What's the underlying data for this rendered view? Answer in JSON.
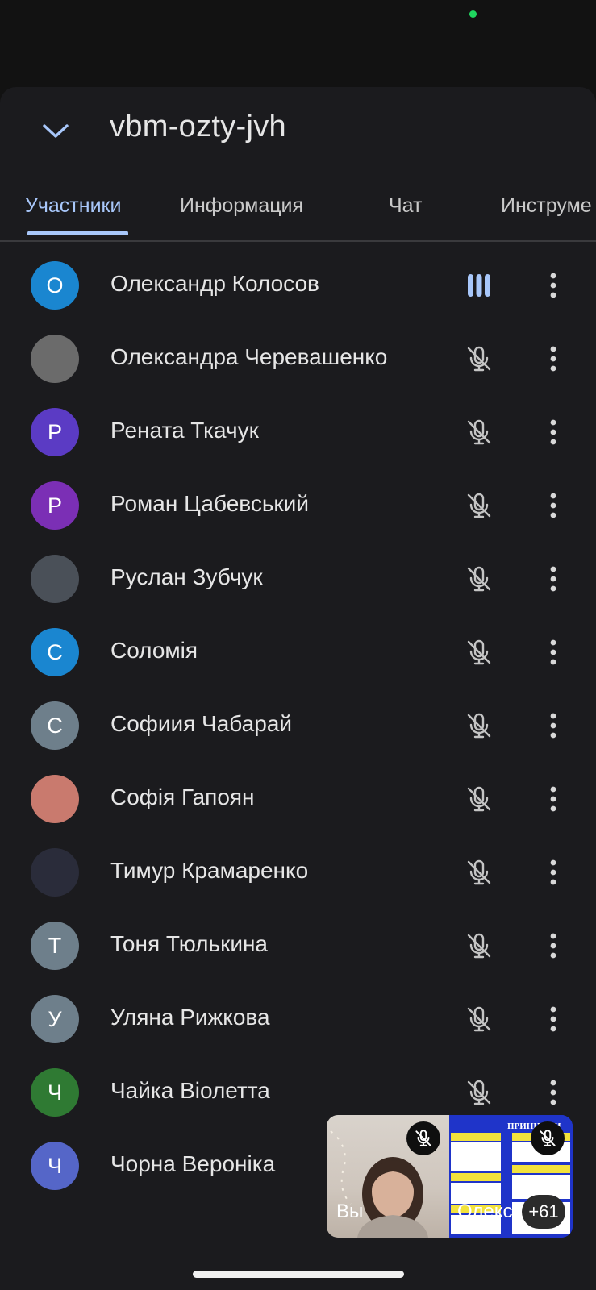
{
  "meeting": {
    "code": "vbm-ozty-jvh"
  },
  "tabs": [
    {
      "label": "Участники",
      "active": true
    },
    {
      "label": "Информация",
      "active": false
    },
    {
      "label": "Чат",
      "active": false
    },
    {
      "label": "Инструме",
      "active": false
    }
  ],
  "participants": [
    {
      "initial": "О",
      "name": "Олександр Колосов",
      "avatar_color": "#1a86d0",
      "mic": "speaking-icon"
    },
    {
      "initial": "",
      "name": "Олександра Черевашенко",
      "avatar_color": "#6b6b6b",
      "mic": "mic-off-icon"
    },
    {
      "initial": "Р",
      "name": "Рената Ткачук",
      "avatar_color": "#5b3bc4",
      "mic": "mic-off-icon"
    },
    {
      "initial": "Р",
      "name": "Роман Цабевський",
      "avatar_color": "#7b2fb5",
      "mic": "mic-off-icon"
    },
    {
      "initial": "",
      "name": "Руслан Зубчук",
      "avatar_color": "#4a5058",
      "mic": "mic-off-icon"
    },
    {
      "initial": "С",
      "name": "Соломія",
      "avatar_color": "#1a86d0",
      "mic": "mic-off-icon"
    },
    {
      "initial": "С",
      "name": "Софиия Чабарай",
      "avatar_color": "#6e7f8b",
      "mic": "mic-off-icon"
    },
    {
      "initial": "",
      "name": "Софія Гапоян",
      "avatar_color": "#c97a6e",
      "mic": "mic-off-icon"
    },
    {
      "initial": "",
      "name": "Тимур Крамаренко",
      "avatar_color": "#2a2c3a",
      "mic": "mic-off-icon"
    },
    {
      "initial": "Т",
      "name": "Тоня Тюлькина",
      "avatar_color": "#6e7f8b",
      "mic": "mic-off-icon"
    },
    {
      "initial": "У",
      "name": "Уляна Рижкова",
      "avatar_color": "#6e7f8b",
      "mic": "mic-off-icon"
    },
    {
      "initial": "Ч",
      "name": "Чайка Віолетта",
      "avatar_color": "#2f7a33",
      "mic": "mic-off-icon"
    },
    {
      "initial": "Ч",
      "name": "Чорна Вероніка",
      "avatar_color": "#5566c8",
      "mic": "none"
    }
  ],
  "pip": {
    "self_label": "Вы",
    "other_label": "Олекс",
    "extra_count": "+61",
    "slide_title": "ПРИНЦИПИ"
  },
  "colors": {
    "accent": "#a8c7fa",
    "status_green": "#1fd65f"
  }
}
